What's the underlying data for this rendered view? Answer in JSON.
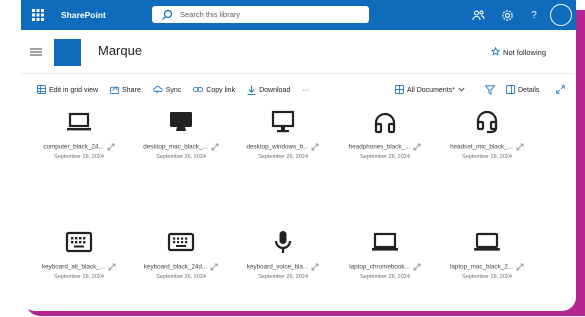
{
  "app": {
    "brand": "SharePoint"
  },
  "search": {
    "placeholder": "Search this library"
  },
  "site": {
    "title": "Marque",
    "follow_label": "Not following"
  },
  "commands": [
    {
      "label": "Edit in grid view",
      "icon": "grid-icon"
    },
    {
      "label": "Share",
      "icon": "share-icon"
    },
    {
      "label": "Sync",
      "icon": "sync-icon"
    },
    {
      "label": "Copy link",
      "icon": "link-icon"
    },
    {
      "label": "Download",
      "icon": "download-icon"
    },
    {
      "label": "···",
      "icon": "more-icon"
    }
  ],
  "view": {
    "label": "All Documents*",
    "details_label": "Details"
  },
  "files": [
    {
      "name": "computer_black_24...",
      "date": "September 26, 2024",
      "icon": "laptop-icon"
    },
    {
      "name": "desktop_mac_black_...",
      "date": "September 26, 2024",
      "icon": "desktop-mac-icon"
    },
    {
      "name": "desktop_windows_b...",
      "date": "September 26, 2024",
      "icon": "desktop-windows-icon"
    },
    {
      "name": "headphones_black_...",
      "date": "September 26, 2024",
      "icon": "headphones-icon"
    },
    {
      "name": "headset_mic_black_...",
      "date": "September 26, 2024",
      "icon": "headset-mic-icon"
    },
    {
      "name": "keyboard_alt_black_...",
      "date": "September 26, 2024",
      "icon": "keyboard-alt-icon"
    },
    {
      "name": "keyboard_black_24d...",
      "date": "September 26, 2024",
      "icon": "keyboard-icon"
    },
    {
      "name": "keyboard_voice_bla...",
      "date": "September 26, 2024",
      "icon": "microphone-icon"
    },
    {
      "name": "laptop_chromebook...",
      "date": "September 26, 2024",
      "icon": "laptop-chromebook-icon"
    },
    {
      "name": "laptop_mac_black_2...",
      "date": "September 26, 2024",
      "icon": "laptop-mac-icon"
    }
  ],
  "colors": {
    "brand_blue": "#0f6cbd",
    "accent_magenta": "#b3258f"
  }
}
